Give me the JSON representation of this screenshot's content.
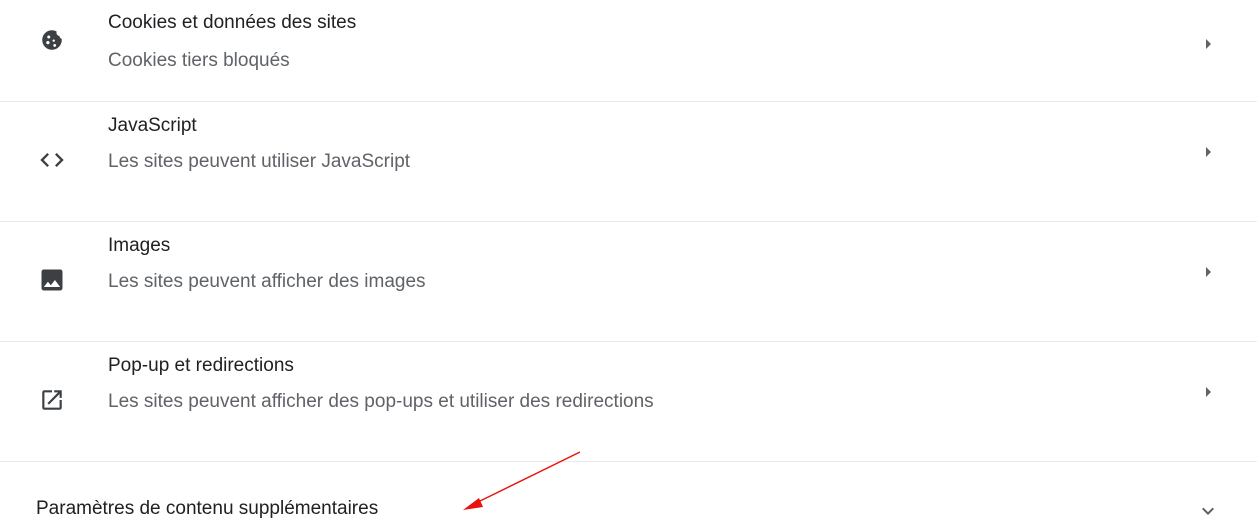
{
  "settings": {
    "rows": [
      {
        "title": "Cookies et données des sites",
        "subtitle": "Cookies tiers bloqués",
        "icon": "cookie-icon"
      },
      {
        "title": "JavaScript",
        "subtitle": "Les sites peuvent utiliser JavaScript",
        "icon": "code-icon"
      },
      {
        "title": "Images",
        "subtitle": "Les sites peuvent afficher des images",
        "icon": "image-icon"
      },
      {
        "title": "Pop-up et redirections",
        "subtitle": "Les sites peuvent afficher des pop-ups et utiliser des redirections",
        "icon": "open-in-new-icon"
      }
    ],
    "more_label": "Paramètres de contenu supplémentaires",
    "more_icon": "expand-more-icon",
    "row_chevron_icon": "arrow-right-icon"
  },
  "colors": {
    "text_primary": "#202124",
    "text_secondary": "#5f6368",
    "icon": "#3c4043",
    "chevron": "#5f6368",
    "divider": "#e8eaed",
    "annotation_arrow": "#e8130c"
  },
  "annotation": {
    "icon": "red-arrow-icon"
  }
}
